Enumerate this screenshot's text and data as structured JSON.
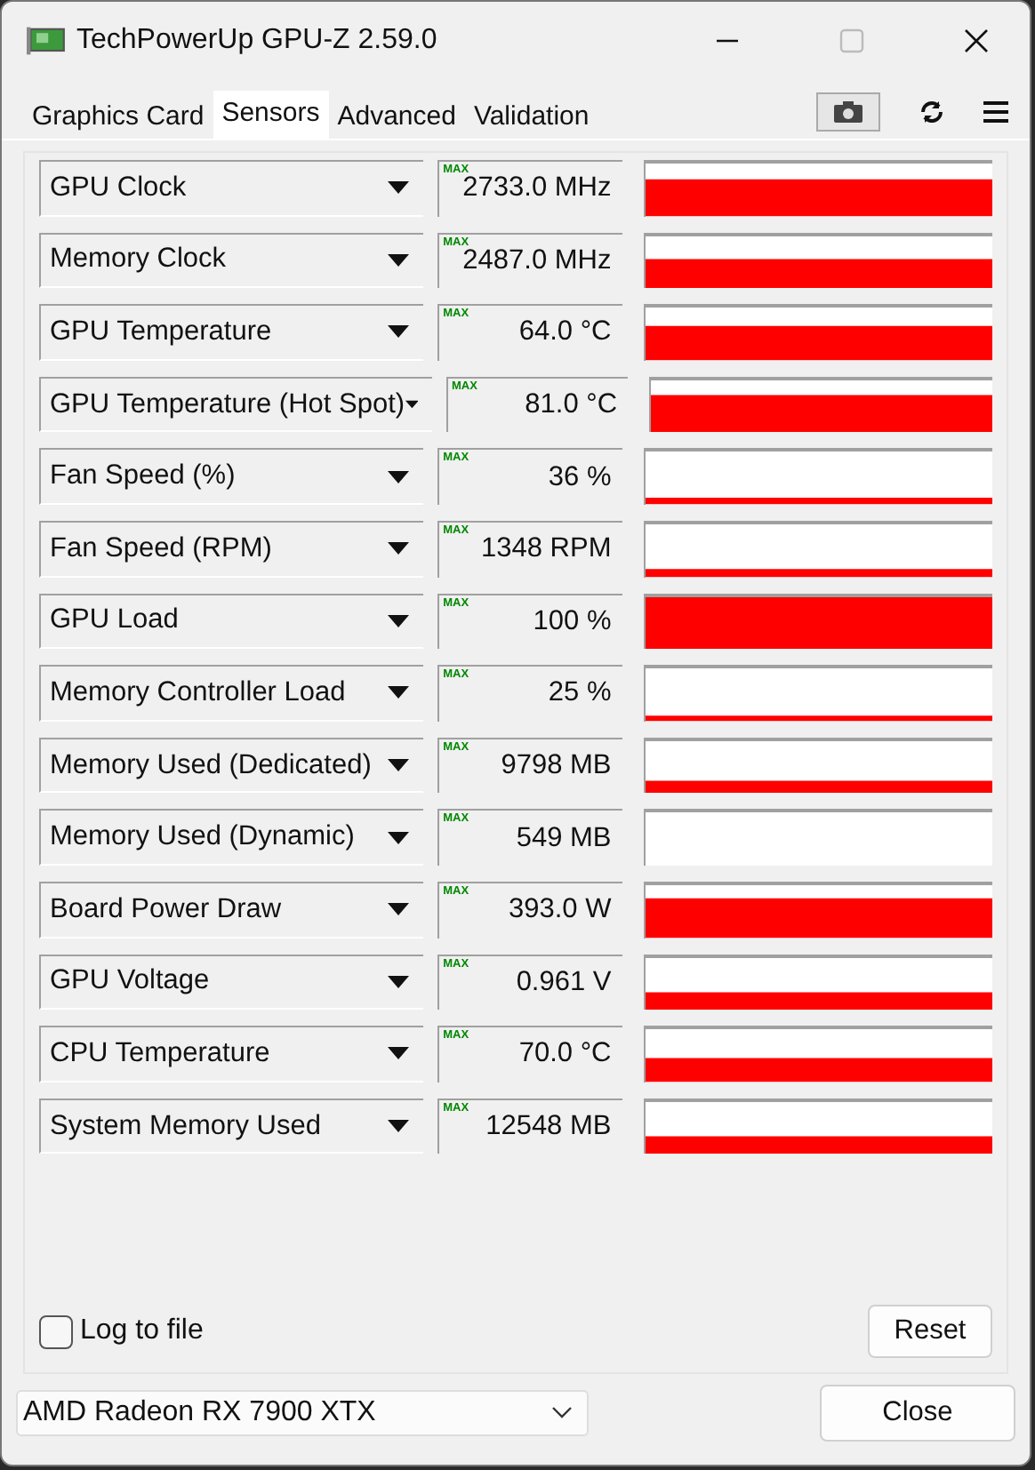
{
  "window": {
    "title": "TechPowerUp GPU-Z 2.59.0"
  },
  "tabs": [
    {
      "label": "Graphics Card",
      "selected": false
    },
    {
      "label": "Sensors",
      "selected": true
    },
    {
      "label": "Advanced",
      "selected": false
    },
    {
      "label": "Validation",
      "selected": false
    }
  ],
  "sensors": [
    {
      "name": "GPU Clock",
      "tag": "MAX",
      "value": "2733.0 MHz"
    },
    {
      "name": "Memory Clock",
      "tag": "MAX",
      "value": "2487.0 MHz"
    },
    {
      "name": "GPU Temperature",
      "tag": "MAX",
      "value": "64.0 °C"
    },
    {
      "name": "GPU Temperature (Hot Spot)",
      "tag": "MAX",
      "value": "81.0 °C"
    },
    {
      "name": "Fan Speed (%)",
      "tag": "MAX",
      "value": "36 %"
    },
    {
      "name": "Fan Speed (RPM)",
      "tag": "MAX",
      "value": "1348 RPM"
    },
    {
      "name": "GPU Load",
      "tag": "MAX",
      "value": "100 %"
    },
    {
      "name": "Memory Controller Load",
      "tag": "MAX",
      "value": "25 %"
    },
    {
      "name": "Memory Used (Dedicated)",
      "tag": "MAX",
      "value": "9798 MB"
    },
    {
      "name": "Memory Used (Dynamic)",
      "tag": "MAX",
      "value": "549 MB"
    },
    {
      "name": "Board Power Draw",
      "tag": "MAX",
      "value": "393.0 W"
    },
    {
      "name": "GPU Voltage",
      "tag": "MAX",
      "value": "0.961 V"
    },
    {
      "name": "CPU Temperature",
      "tag": "MAX",
      "value": "70.0 °C"
    },
    {
      "name": "System Memory Used",
      "tag": "MAX",
      "value": "12548 MB"
    }
  ],
  "log_to_file": {
    "label": "Log to file",
    "checked": false
  },
  "reset_button": "Reset",
  "device_select": {
    "value": "AMD Radeon RX 7900 XTX"
  },
  "close_button": "Close"
}
